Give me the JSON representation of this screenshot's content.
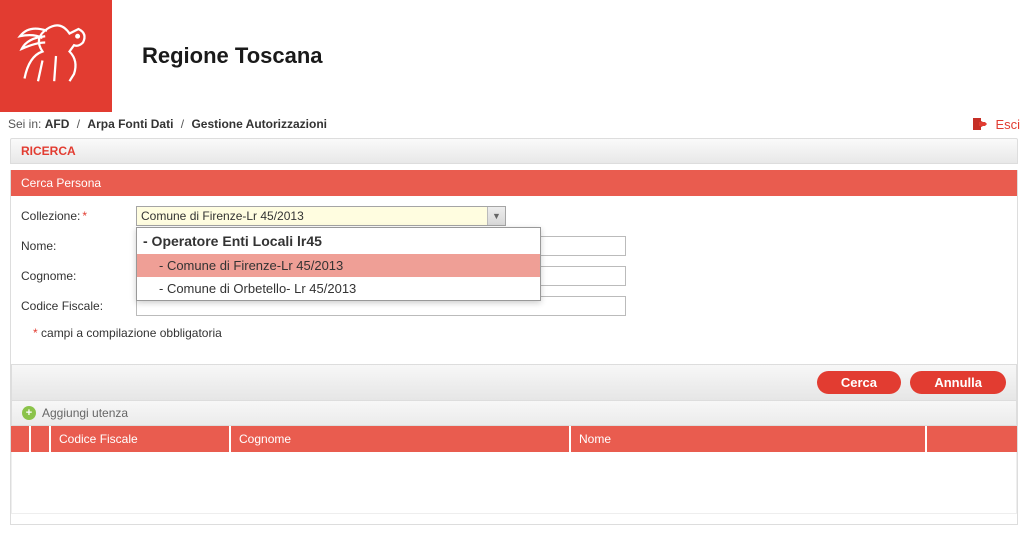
{
  "header": {
    "title": "Regione Toscana"
  },
  "breadcrumb": {
    "prefix": "Sei in:",
    "items": [
      "AFD",
      "Arpa Fonti Dati",
      "Gestione Autorizzazioni"
    ]
  },
  "logout": {
    "label": "Esci"
  },
  "search": {
    "header": "RICERCA",
    "panel_title": "Cerca Persona",
    "fields": {
      "collezione": {
        "label": "Collezione:",
        "value": "Comune di Firenze-Lr 45/2013"
      },
      "nome": {
        "label": "Nome:",
        "value": ""
      },
      "cognome": {
        "label": "Cognome:",
        "value": ""
      },
      "codice_fiscale": {
        "label": "Codice Fiscale:",
        "value": ""
      }
    },
    "dropdown": {
      "group_header": "- Operatore Enti Locali lr45",
      "options": [
        {
          "label": "- Comune di Firenze-Lr 45/2013",
          "selected": true
        },
        {
          "label": "- Comune di Orbetello- Lr 45/2013",
          "selected": false
        }
      ]
    },
    "hint": "campi a compilazione obbligatoria",
    "buttons": {
      "search": "Cerca",
      "cancel": "Annulla"
    }
  },
  "grid": {
    "add_label": "Aggiungi utenza",
    "columns": {
      "codice_fiscale": "Codice Fiscale",
      "cognome": "Cognome",
      "nome": "Nome"
    }
  }
}
